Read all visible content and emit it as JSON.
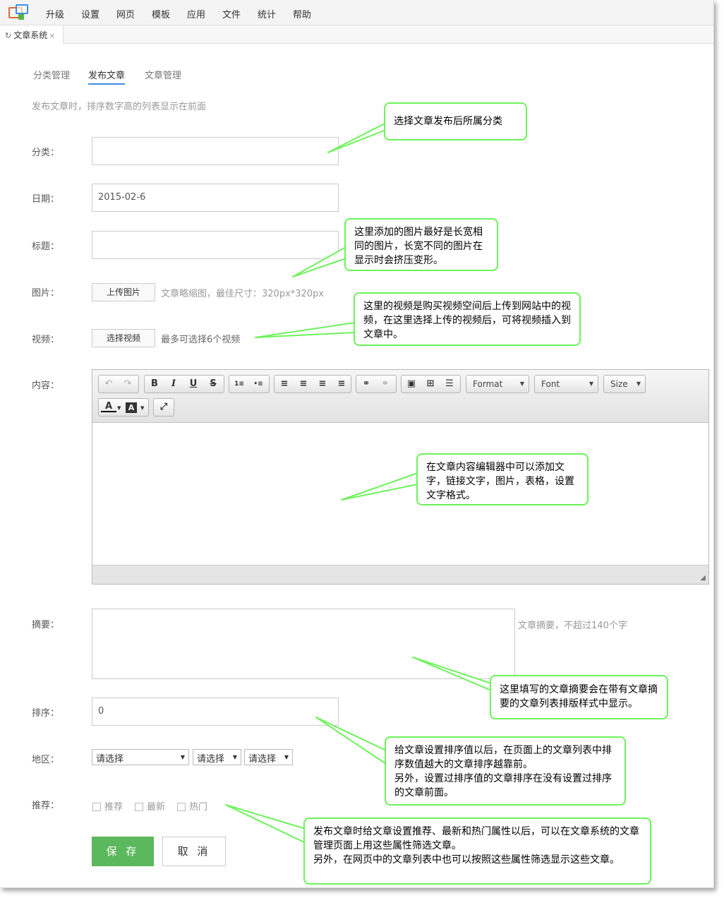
{
  "menu": [
    "升级",
    "设置",
    "网页",
    "模板",
    "应用",
    "文件",
    "统计",
    "帮助"
  ],
  "doc_tab": {
    "label": "文章系统",
    "refresh_icon": "↻",
    "close_icon": "×"
  },
  "subtabs": [
    "分类管理",
    "发布文章",
    "文章管理"
  ],
  "hint": "发布文章时，排序数字高的列表显示在前面",
  "form": {
    "category_label": "分类：",
    "date_label": "日期：",
    "date_value": "2015-02-6",
    "title_label": "标题：",
    "image_label": "图片：",
    "upload_button": "上传图片",
    "image_note": "文章略缩图，最佳尺寸：320px*320px",
    "video_label": "视频：",
    "video_button": "选择视频",
    "video_note": "最多可选择6个视频",
    "content_label": "内容：",
    "summary_label": "摘要：",
    "summary_note": "文章摘要，不超过140个字",
    "order_label": "排序：",
    "order_value": "0",
    "region_label": "地区：",
    "region_selects": [
      "请选择",
      "请选择",
      "请选择"
    ],
    "recommend_label": "推荐：",
    "checkboxes": [
      "推荐",
      "最新",
      "热门"
    ],
    "save_button": "保 存",
    "cancel_button": "取 消"
  },
  "editor": {
    "format_combo": "Format",
    "font_combo": "Font",
    "size_combo": "Size",
    "buttons": {
      "undo": "↶",
      "redo": "↷",
      "bold": "B",
      "italic": "I",
      "underline": "U",
      "strike": "S",
      "numbered": "1≡",
      "bulleted": "•≡",
      "align_left": "≡",
      "align_center": "≡",
      "align_right": "≡",
      "justify": "≡",
      "link": "⚭",
      "unlink": "⚭",
      "image": "▣",
      "table": "⊞",
      "hr": "☰",
      "text_color": "A",
      "bg_color": "A",
      "maximize": "⤢"
    },
    "grip": "◢"
  },
  "callouts": {
    "category": "选择文章发布后所属分类",
    "image": "这里添加的图片最好是长宽相同的图片，长宽不同的图片在显示时会挤压变形。",
    "video": "这里的视频是购买视频空间后上传到网站中的视频，在这里选择上传的视频后，可将视频插入到文章中。",
    "content": "在文章内容编辑器中可以添加文字，链接文字，图片，表格，设置文字格式。",
    "summary": "这里填写的文章摘要会在带有文章摘要的文章列表排版样式中显示。",
    "order": "给文章设置排序值以后，在页面上的文章列表中排序数值越大的文章排序越靠前。\n另外，设置过排序值的文章排序在没有设置过排序的文章前面。",
    "recommend": "发布文章时给文章设置推荐、最新和热门属性以后，可以在文章系统的文章管理页面上用这些属性筛选文章。\n另外，在网页中的文章列表中也可以按照这些属性筛选显示这些文章。"
  },
  "colors": {
    "accent": "#3c8ee0",
    "save": "#5cb85c",
    "callout_border": "#6cf35a"
  }
}
